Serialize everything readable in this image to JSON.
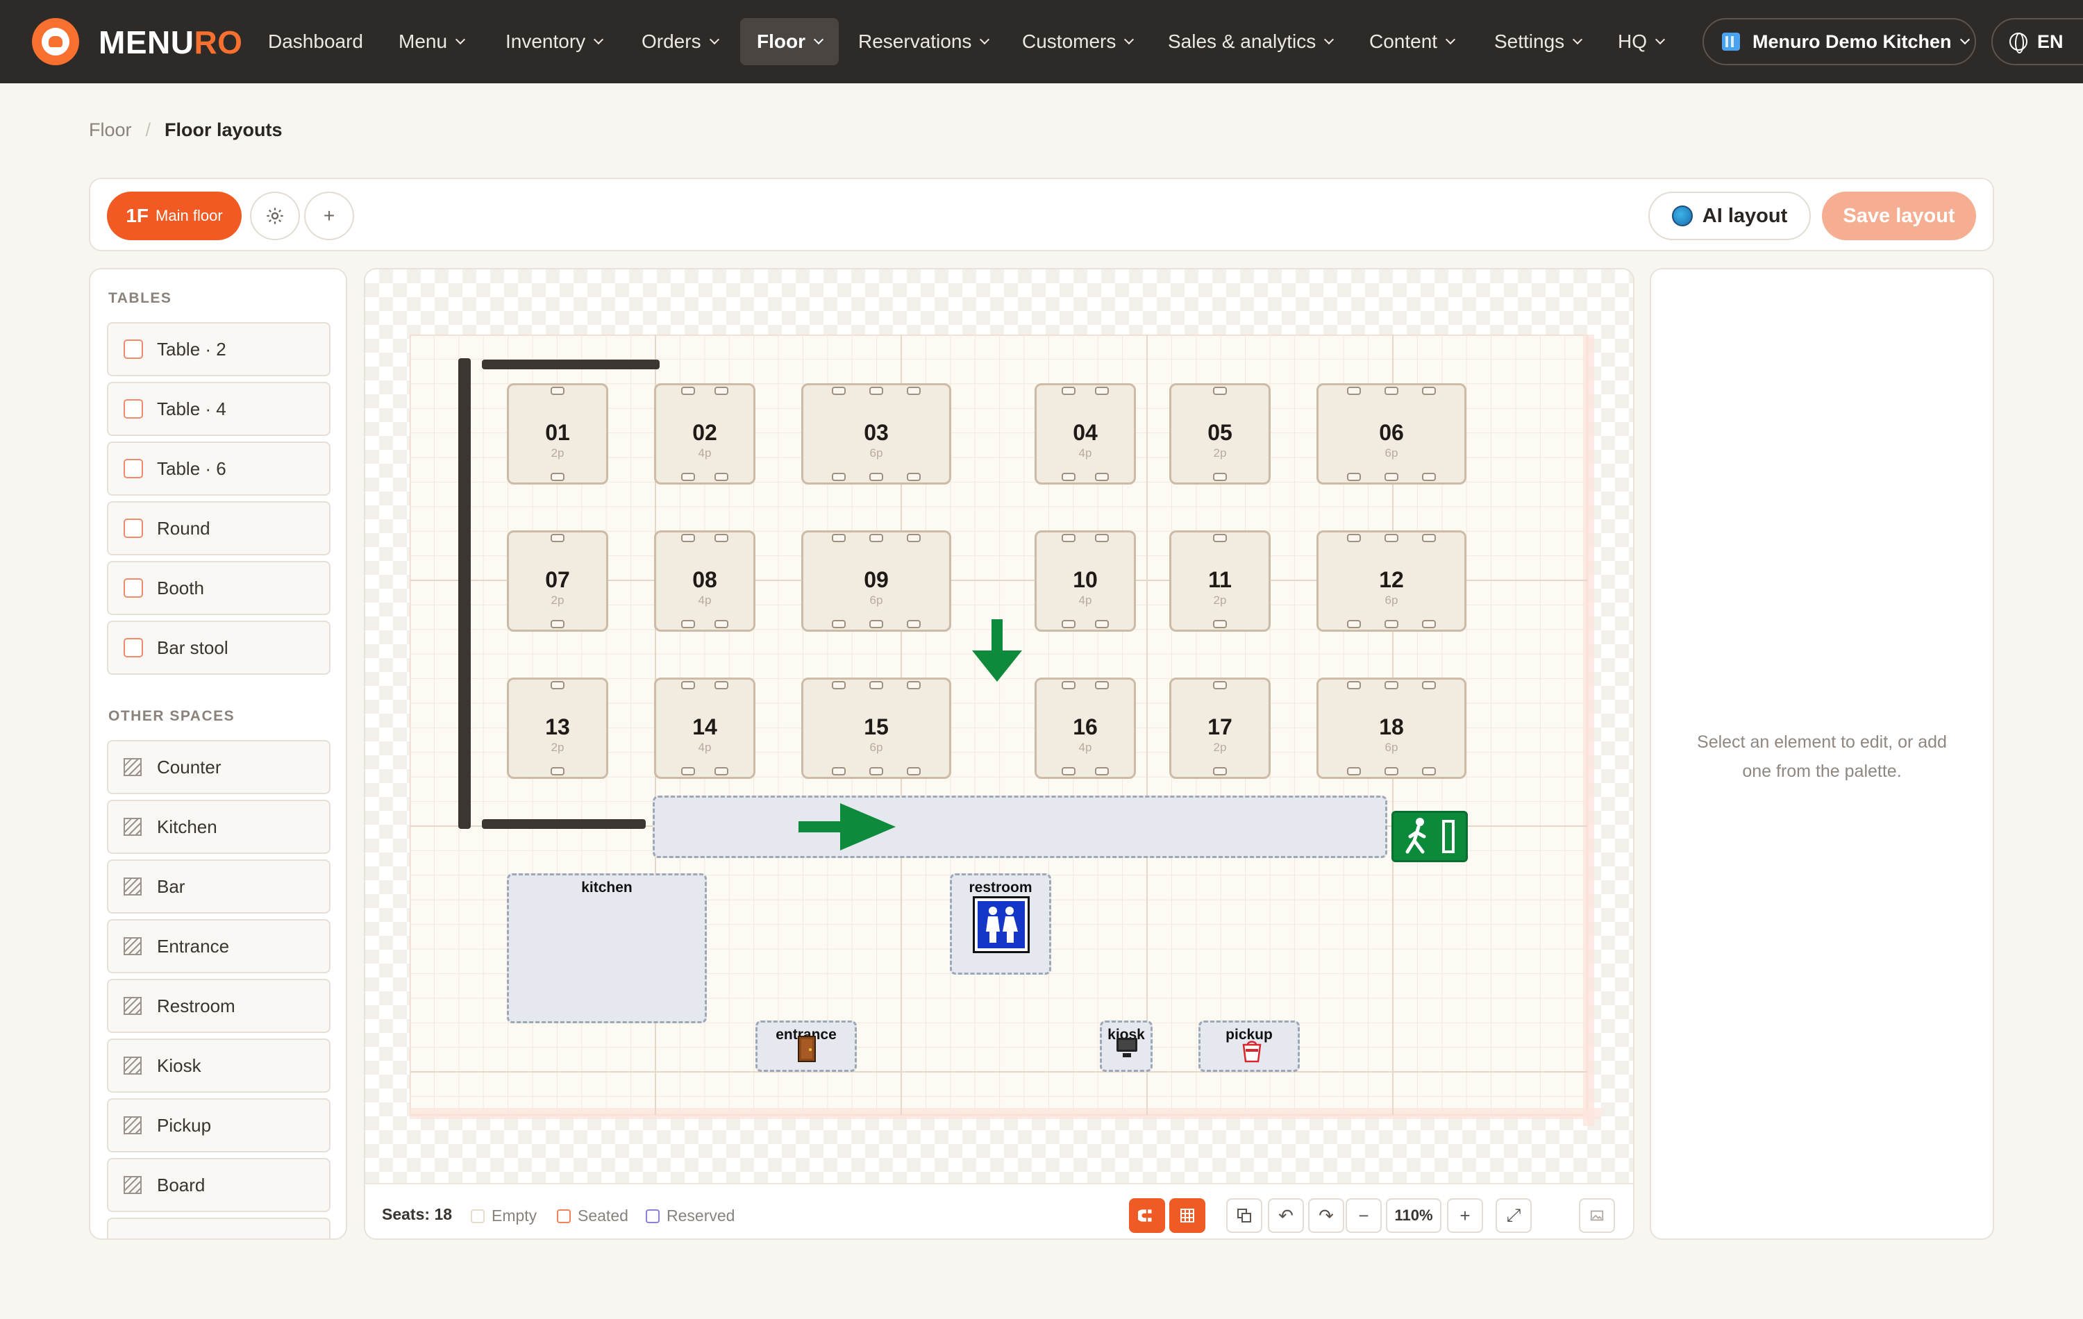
{
  "brand": {
    "name_main": "MENU",
    "name_accent": "RO"
  },
  "nav": {
    "items": [
      {
        "label": "Dashboard",
        "dropdown": false
      },
      {
        "label": "Menu",
        "dropdown": true
      },
      {
        "label": "Inventory",
        "dropdown": true
      },
      {
        "label": "Orders",
        "dropdown": true
      },
      {
        "label": "Floor",
        "dropdown": true,
        "active": true
      },
      {
        "label": "Reservations",
        "dropdown": true
      },
      {
        "label": "Customers",
        "dropdown": true
      },
      {
        "label": "Sales & analytics",
        "dropdown": true
      },
      {
        "label": "Content",
        "dropdown": true
      },
      {
        "label": "Settings",
        "dropdown": true
      },
      {
        "label": "HQ",
        "dropdown": true
      }
    ],
    "store": "Menuro Demo Kitchen",
    "language": "EN"
  },
  "breadcrumb": {
    "parent": "Floor",
    "current": "Floor layouts"
  },
  "toolbar": {
    "floor_code": "1F",
    "floor_name": "Main floor",
    "settings_icon": "gear-icon",
    "add_label": "+",
    "ai_label": "AI layout",
    "save_label": "Save layout"
  },
  "palette": {
    "tables_heading": "TABLES",
    "tables": [
      "Table · 2",
      "Table · 4",
      "Table · 6",
      "Round",
      "Booth",
      "Bar stool"
    ],
    "spaces_heading": "OTHER SPACES",
    "spaces": [
      "Counter",
      "Kitchen",
      "Bar",
      "Entrance",
      "Restroom",
      "Kiosk",
      "Pickup",
      "Board"
    ]
  },
  "floor": {
    "tables": [
      {
        "num": "01",
        "cap": "2p"
      },
      {
        "num": "02",
        "cap": "4p"
      },
      {
        "num": "03",
        "cap": "6p"
      },
      {
        "num": "04",
        "cap": "4p"
      },
      {
        "num": "05",
        "cap": "2p"
      },
      {
        "num": "06",
        "cap": "6p"
      },
      {
        "num": "07",
        "cap": "2p"
      },
      {
        "num": "08",
        "cap": "4p"
      },
      {
        "num": "09",
        "cap": "6p"
      },
      {
        "num": "10",
        "cap": "4p"
      },
      {
        "num": "11",
        "cap": "2p"
      },
      {
        "num": "12",
        "cap": "6p"
      },
      {
        "num": "13",
        "cap": "2p"
      },
      {
        "num": "14",
        "cap": "4p"
      },
      {
        "num": "15",
        "cap": "6p"
      },
      {
        "num": "16",
        "cap": "4p"
      },
      {
        "num": "17",
        "cap": "2p"
      },
      {
        "num": "18",
        "cap": "6p"
      }
    ],
    "zones": {
      "kitchen": "kitchen",
      "restroom": "restroom",
      "entrance": "entrance",
      "kiosk": "kiosk",
      "pickup": "pickup"
    }
  },
  "status": {
    "seats_label": "Seats:",
    "seats_value": "18",
    "legend": [
      "Empty",
      "Seated",
      "Reserved"
    ],
    "zoom": "110%"
  },
  "props": {
    "hint": "Select an element to edit, or add one from the palette."
  },
  "colors": {
    "brand": "#f15a22",
    "nav_bg": "#2e2a27",
    "exit_green": "#0b8a3a",
    "restroom_blue": "#1437c8"
  }
}
